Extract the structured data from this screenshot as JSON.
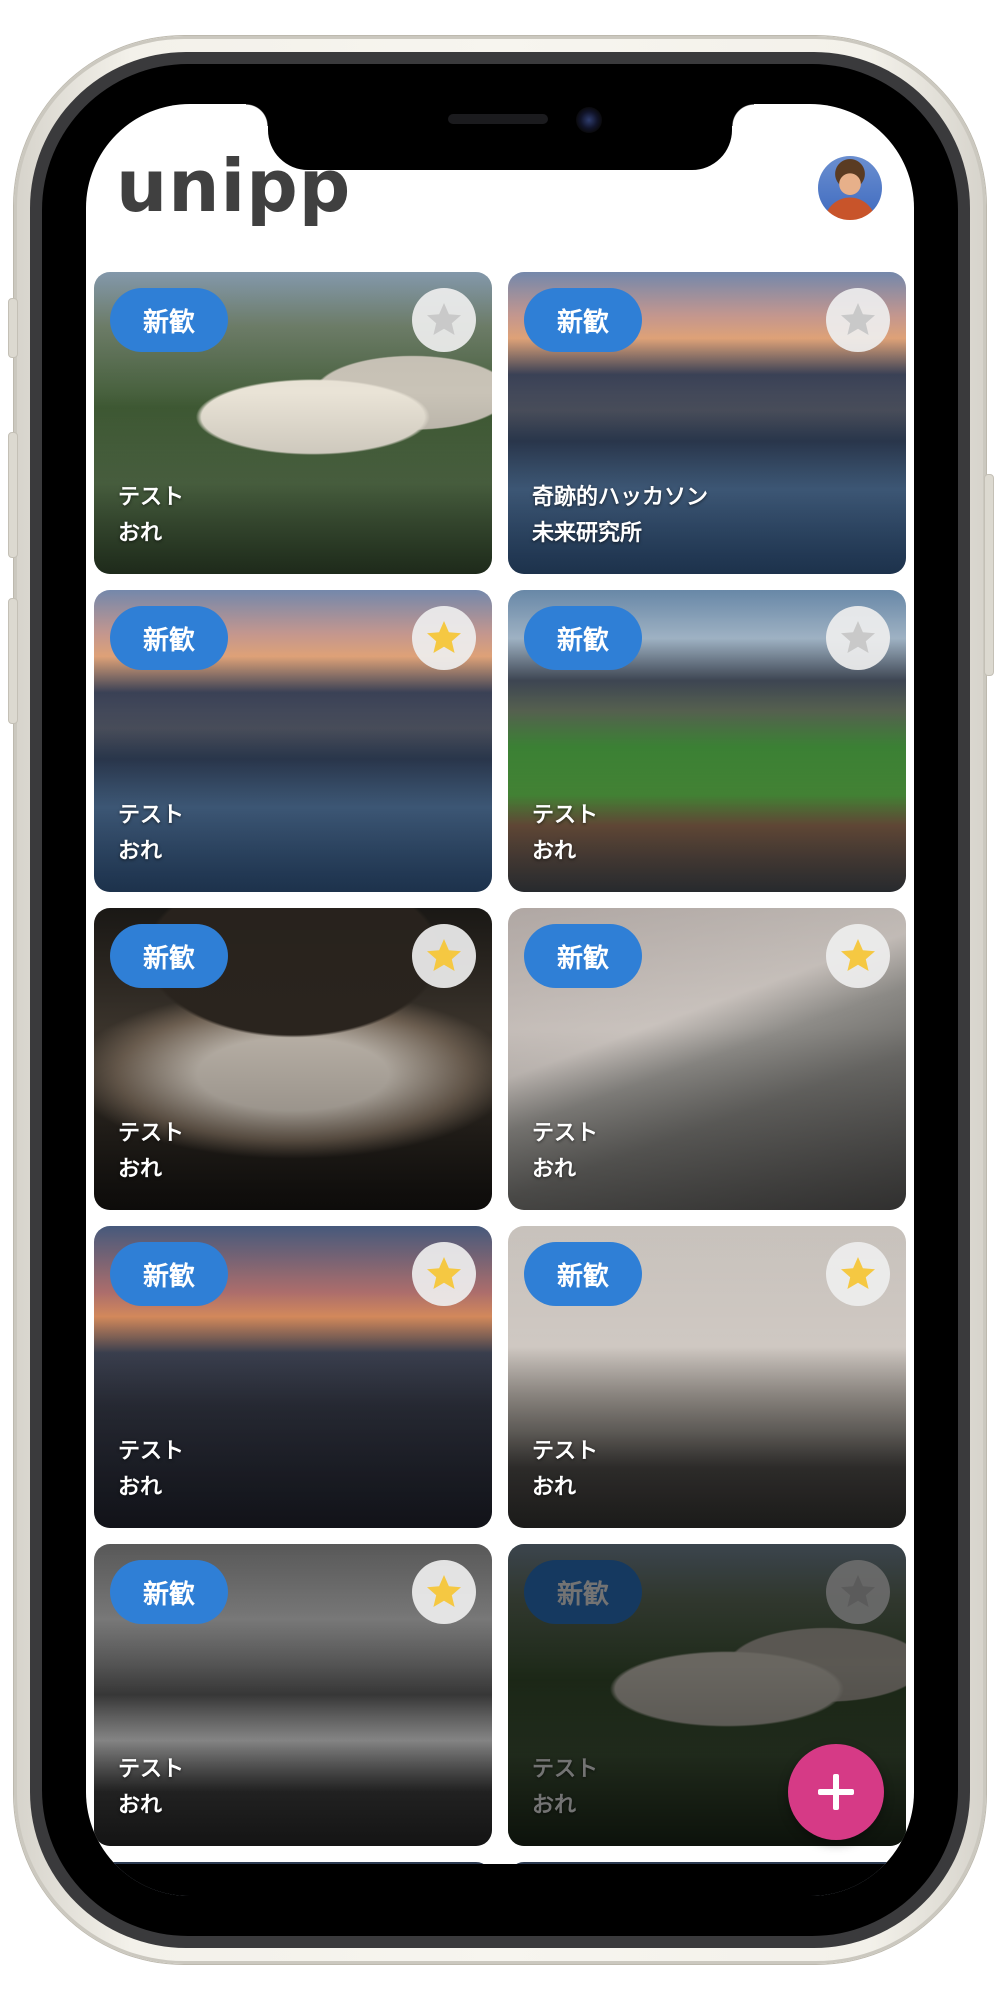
{
  "app": {
    "logo_text": "unipp",
    "accent_color": "#2f7fd6",
    "fab_color": "#d63a86",
    "avatar_icon": "user-avatar"
  },
  "cards": [
    {
      "badge": "新歓",
      "title": "テスト",
      "author": "おれ",
      "favorited": false,
      "image": "aerial-palace"
    },
    {
      "badge": "新歓",
      "title": "奇跡的ハッカソン",
      "author": "未来研究所",
      "favorited": false,
      "image": "city-waterfront-dusk"
    },
    {
      "badge": "新歓",
      "title": "テスト",
      "author": "おれ",
      "favorited": true,
      "image": "city-waterfront-dusk"
    },
    {
      "badge": "新歓",
      "title": "テスト",
      "author": "おれ",
      "favorited": false,
      "image": "ballpark"
    },
    {
      "badge": "新歓",
      "title": "テスト",
      "author": "おれ",
      "favorited": true,
      "image": "dome-interior"
    },
    {
      "badge": "新歓",
      "title": "テスト",
      "author": "おれ",
      "favorited": true,
      "image": "climber-rock"
    },
    {
      "badge": "新歓",
      "title": "テスト",
      "author": "おれ",
      "favorited": true,
      "image": "city-night"
    },
    {
      "badge": "新歓",
      "title": "テスト",
      "author": "おれ",
      "favorited": true,
      "image": "plane-wreck"
    },
    {
      "badge": "新歓",
      "title": "テスト",
      "author": "おれ",
      "favorited": true,
      "image": "grand-hall-bw"
    },
    {
      "badge": "新歓",
      "title": "テスト",
      "author": "おれ",
      "favorited": false,
      "image": "aerial-palace"
    }
  ],
  "fab_icon": "plus-icon"
}
